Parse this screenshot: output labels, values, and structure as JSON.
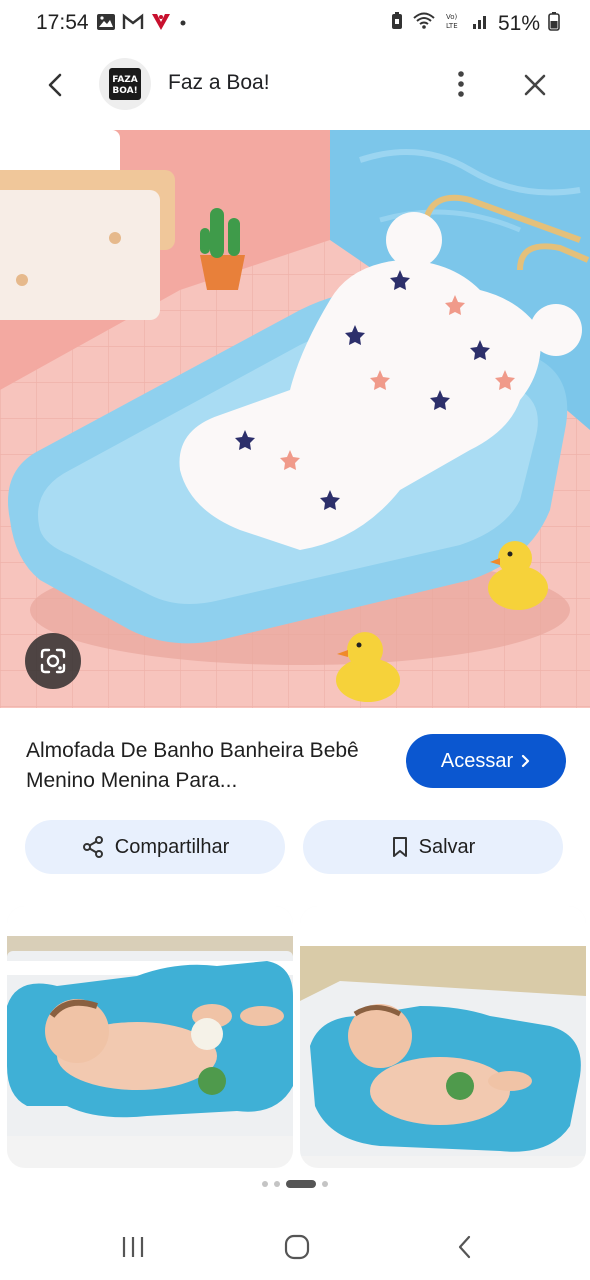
{
  "status_bar": {
    "time": "17:54",
    "battery": "51%",
    "icons": [
      "gallery-icon",
      "gmail-icon",
      "vivo-icon",
      "dot-icon",
      "battery-saver-icon",
      "wifi-icon",
      "volte-icon",
      "signal-icon",
      "battery-icon"
    ]
  },
  "header": {
    "site_name": "Faz a Boa!",
    "logo_text": "FAZA BOA!"
  },
  "product": {
    "title": "Almofada De Banho Banheira Bebê Menino Menina Para...",
    "visit_label": "Acessar"
  },
  "actions": {
    "share_label": "Compartilhar",
    "save_label": "Salvar"
  },
  "carousel": {
    "dot_count": 4,
    "active_index": 2
  },
  "colors": {
    "primary_button": "#0b57d0",
    "tonal_button": "#e8f0fd"
  }
}
